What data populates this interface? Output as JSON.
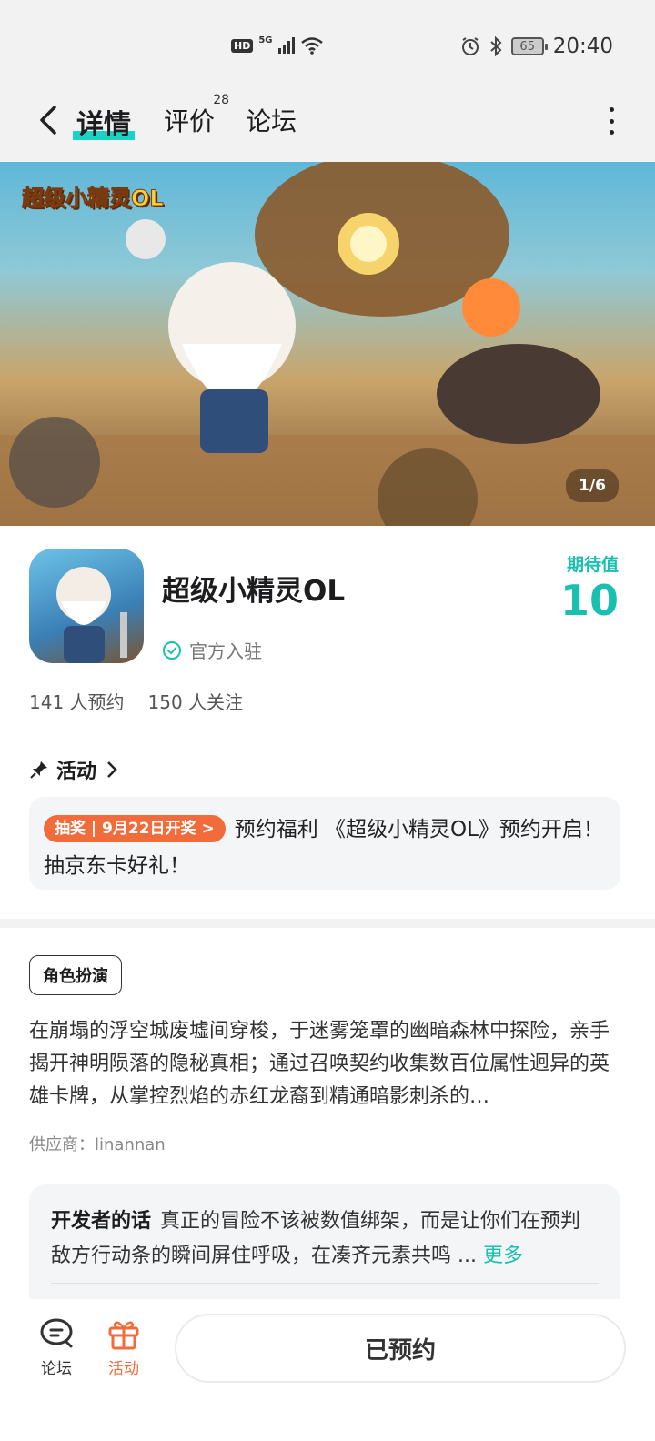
{
  "status_bar": {
    "hd": "HD",
    "network": "5G",
    "time": "20:40",
    "battery": "65"
  },
  "nav": {
    "tabs": [
      {
        "label": "详情",
        "active": true
      },
      {
        "label": "评价",
        "badge": "28"
      },
      {
        "label": "论坛"
      }
    ]
  },
  "banner": {
    "logo_text": "超级小精灵OL",
    "page_indicator": "1/6"
  },
  "game": {
    "title": "超级小精灵OL",
    "official_label": "官方入驻",
    "expect_label": "期待值",
    "expect_value": "10",
    "reservations": "141 人预约",
    "followers": "150 人关注"
  },
  "activity": {
    "header": "活动",
    "badge": "抽奖 | 9月22日开奖 >",
    "text": "预约福利 《超级小精灵OL》预约开启！抽京东卡好礼！"
  },
  "details": {
    "genre": "角色扮演",
    "description": "在崩塌的浮空城废墟间穿梭，于迷雾笼罩的幽暗森林中探险，亲手揭开神明陨落的隐秘真相；通过召唤契约收集数百位属性迥异的英雄卡牌，从掌控烈焰的赤红龙裔到精通暗影刺杀的…",
    "supplier_label": "供应商：",
    "supplier": "linannan"
  },
  "developer": {
    "label": "开发者的话",
    "text": "真正的冒险不该被数值绑架，而是让你们在预判敌方行动条的瞬间屏住呼吸，在凑齐元素共鸣 ... ",
    "more": "更多"
  },
  "bottom_bar": {
    "forum_label": "论坛",
    "activity_label": "活动",
    "reserve_button": "已预约"
  },
  "colors": {
    "accent": "#19bfb1",
    "orange": "#f26b3a"
  }
}
